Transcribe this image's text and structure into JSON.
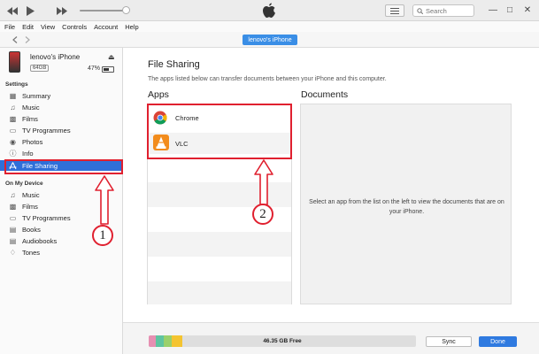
{
  "menu": [
    "File",
    "Edit",
    "View",
    "Controls",
    "Account",
    "Help"
  ],
  "search": {
    "placeholder": "Search"
  },
  "nav": {
    "device_pill": "lenovo's iPhone"
  },
  "device": {
    "name": "lenovo's iPhone",
    "capacity": "64GB",
    "battery": "47%"
  },
  "sidebar": {
    "settings_header": "Settings",
    "settings_items": [
      {
        "label": "Summary",
        "icon": "summary-icon"
      },
      {
        "label": "Music",
        "icon": "music-note-icon"
      },
      {
        "label": "Films",
        "icon": "film-icon"
      },
      {
        "label": "TV Programmes",
        "icon": "tv-icon"
      },
      {
        "label": "Photos",
        "icon": "camera-icon"
      },
      {
        "label": "Info",
        "icon": "info-icon"
      },
      {
        "label": "File Sharing",
        "icon": "app-store-icon"
      }
    ],
    "ondevice_header": "On My Device",
    "ondevice_items": [
      {
        "label": "Music",
        "icon": "music-note-icon"
      },
      {
        "label": "Films",
        "icon": "film-icon"
      },
      {
        "label": "TV Programmes",
        "icon": "tv-icon"
      },
      {
        "label": "Books",
        "icon": "book-icon"
      },
      {
        "label": "Audiobooks",
        "icon": "audiobook-icon"
      },
      {
        "label": "Tones",
        "icon": "bell-icon"
      }
    ]
  },
  "main": {
    "title": "File Sharing",
    "subtitle": "The apps listed below can transfer documents between your iPhone and this computer.",
    "apps_header": "Apps",
    "documents_header": "Documents",
    "apps": [
      {
        "label": "Chrome"
      },
      {
        "label": "VLC"
      }
    ],
    "documents_message": "Select an app from the list on the left to view the documents that are on your iPhone."
  },
  "bottom": {
    "storage_free": "46.35 GB Free",
    "sync_label": "Sync",
    "done_label": "Done"
  },
  "annotations": {
    "step1": "1",
    "step2": "2"
  },
  "colors": {
    "accent": "#2f6fd9",
    "annotation_red": "#e0202f",
    "done_blue": "#2f7ae0"
  }
}
